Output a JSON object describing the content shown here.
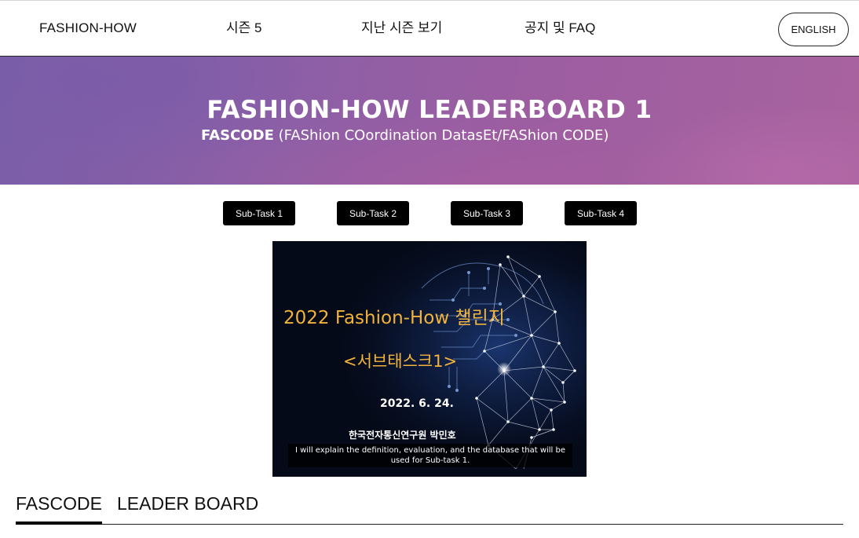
{
  "nav": {
    "logo": "FASHION-HOW",
    "items": [
      {
        "label": "시즌 5"
      },
      {
        "label": "지난 시즌 보기"
      },
      {
        "label": "공지 및 FAQ"
      }
    ],
    "language_button": "ENGLISH"
  },
  "hero": {
    "title": "FASHION-HOW LEADERBOARD 1",
    "subtitle_strong": "FASCODE",
    "subtitle_rest": " (FAShion COordination DatasEt/FAShion CODE)",
    "gradient_colors": [
      "#7a5ea8",
      "#a8639f"
    ]
  },
  "subtasks": [
    {
      "label": "Sub-Task 1"
    },
    {
      "label": "Sub-Task 2"
    },
    {
      "label": "Sub-Task 3"
    },
    {
      "label": "Sub-Task 4"
    }
  ],
  "video": {
    "title": "2022 Fashion-How 챌린지",
    "subtitle": "<서브태스크1>",
    "date": "2022. 6. 24.",
    "presenter": "한국전자통신연구원  박민호",
    "caption": "I will explain the definition, evaluation, and the database that will be used for Sub-task 1.",
    "accent_color": "#f1b33b",
    "background_color": "#050a18"
  },
  "tabs": [
    {
      "label": "FASCODE",
      "active": true
    },
    {
      "label": "LEADER BOARD",
      "active": false
    }
  ]
}
